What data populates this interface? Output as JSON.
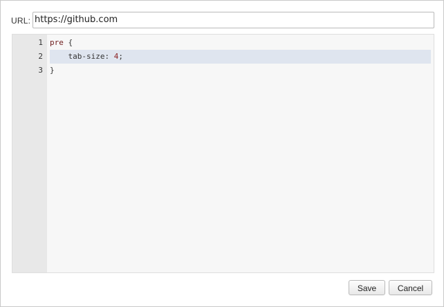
{
  "url": {
    "label": "URL:",
    "value": "https://github.com"
  },
  "editor": {
    "lines": [
      {
        "number": "1",
        "tokens": [
          {
            "type": "selector",
            "text": "pre"
          },
          {
            "type": "punc",
            "text": " {"
          }
        ]
      },
      {
        "number": "2",
        "tokens": [
          {
            "type": "prop",
            "text": "    tab-size: "
          },
          {
            "type": "num",
            "text": "4"
          },
          {
            "type": "punc",
            "text": ";"
          }
        ]
      },
      {
        "number": "3",
        "tokens": [
          {
            "type": "punc",
            "text": "}"
          }
        ]
      }
    ],
    "active_line": 2
  },
  "buttons": {
    "save_label": "Save",
    "cancel_label": "Cancel"
  }
}
